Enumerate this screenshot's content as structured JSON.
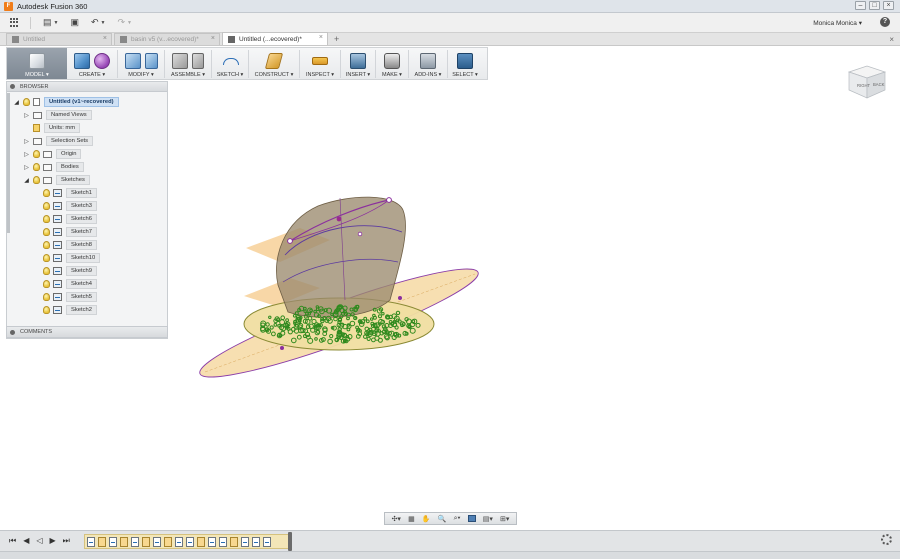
{
  "window": {
    "title": "Autodesk Fusion 360",
    "app_icon_letter": "F"
  },
  "qat": {
    "user": "Monica Monica ▾",
    "help": "?"
  },
  "tabs": [
    {
      "label": "Untitled",
      "active": false
    },
    {
      "label": "basin v5 (v...ecovered)*",
      "active": false
    },
    {
      "label": "Untitled (...ecovered)*",
      "active": true
    }
  ],
  "toolbar": {
    "model": "MODEL ▾",
    "create": "CREATE ▾",
    "modify": "MODIFY ▾",
    "assemble": "ASSEMBLE ▾",
    "sketch": "SKETCH ▾",
    "construct": "CONSTRUCT ▾",
    "inspect": "INSPECT ▾",
    "insert": "INSERT ▾",
    "make": "MAKE ▾",
    "addins": "ADD-INS ▾",
    "select": "SELECT ▾"
  },
  "viewcube": {
    "front": "RIGHT",
    "side": "BACK"
  },
  "browser": {
    "header": "BROWSER",
    "root": "Untitled (v1~recovered)",
    "named_views": "Named Views",
    "units": "Units: mm",
    "selection_sets": "Selection Sets",
    "origin": "Origin",
    "bodies": "Bodies",
    "sketches": "Sketches",
    "sketch_items": [
      "Sketch1",
      "Sketch3",
      "Sketch6",
      "Sketch7",
      "Sketch8",
      "Sketch10",
      "Sketch9",
      "Sketch4",
      "Sketch5",
      "Sketch2"
    ]
  },
  "comments": {
    "header": "COMMENTS"
  },
  "colors": {
    "accent_blue": "#2d6fb7",
    "sketch_purple": "#7a2d8f",
    "plane_orange": "#f1b65e",
    "point_green": "#2f8a1e"
  }
}
